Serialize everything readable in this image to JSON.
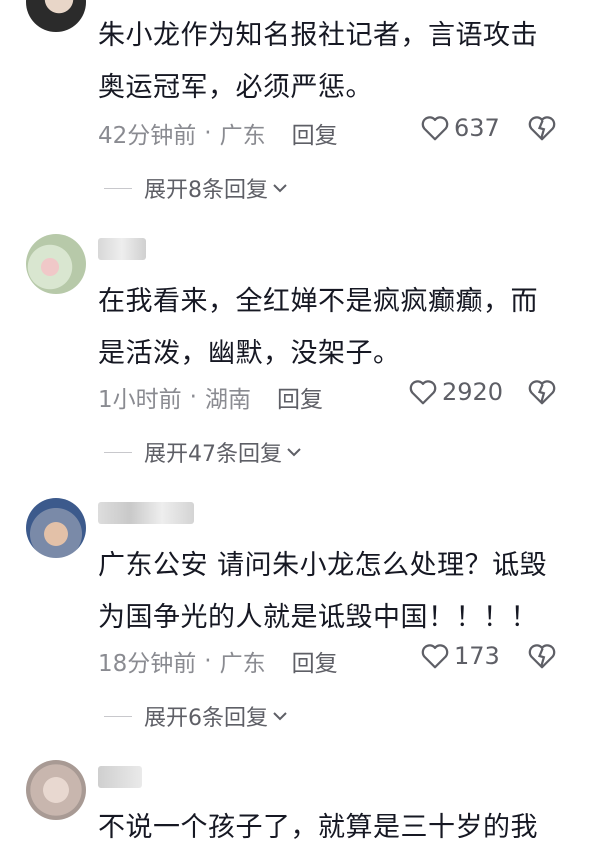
{
  "comments": [
    {
      "text_lines": [
        "朱小龙作为知名报社记者，言语攻击",
        "奥运冠军，必须严惩。"
      ],
      "time": "42分钟前",
      "location": "广东",
      "reply_label": "回复",
      "likes": "637",
      "expand_label": "展开8条回复"
    },
    {
      "text_lines": [
        "在我看来，全红婵不是疯疯癫癫，而",
        "是活泼，幽默，没架子。"
      ],
      "time": "1小时前",
      "location": "湖南",
      "reply_label": "回复",
      "likes": "2920",
      "expand_label": "展开47条回复"
    },
    {
      "text_lines": [
        "广东公安 请问朱小龙怎么处理？诋毁",
        "为国争光的人就是诋毁中国！！！！"
      ],
      "time": "18分钟前",
      "location": "广东",
      "reply_label": "回复",
      "likes": "173",
      "expand_label": "展开6条回复"
    },
    {
      "text_lines": [
        "不说一个孩子了，就算是三十岁的我"
      ]
    }
  ],
  "separator": "·",
  "colors": {
    "text": "#161823",
    "meta": "#8a8b91",
    "action": "#5e5f66"
  },
  "icons": [
    "heart-icon",
    "dislike-icon",
    "chevron-down-icon",
    "user-avatar"
  ]
}
